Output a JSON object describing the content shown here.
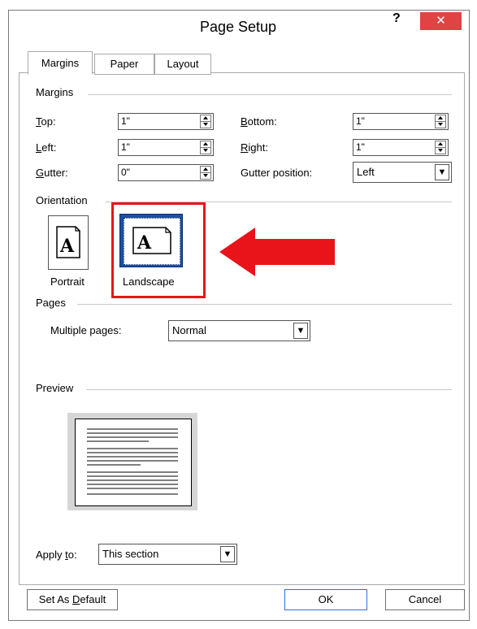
{
  "window": {
    "title": "Page Setup",
    "help_label": "?",
    "close_glyph": "✕"
  },
  "tabs": [
    {
      "label": "Margins",
      "active": true
    },
    {
      "label": "Paper"
    },
    {
      "label": "Layout"
    }
  ],
  "margins": {
    "section_label": "Margins",
    "top": {
      "label": "Top:",
      "value": "1\""
    },
    "bottom": {
      "label": "Bottom:",
      "value": "1\""
    },
    "left": {
      "label": "Left:",
      "value": "1\""
    },
    "right": {
      "label": "Right:",
      "value": "1\""
    },
    "gutter": {
      "label": "Gutter:",
      "value": "0\""
    },
    "gutter_position": {
      "label": "Gutter position:",
      "value": "Left"
    }
  },
  "orientation": {
    "section_label": "Orientation",
    "portrait": {
      "label": "Portrait",
      "icon": "portrait-page-icon"
    },
    "landscape": {
      "label": "Landscape",
      "icon": "landscape-page-icon",
      "selected": true
    },
    "highlight_color": "#e8141a"
  },
  "pages": {
    "section_label": "Pages",
    "multiple_pages_label": "Multiple pages:",
    "multiple_pages_value": "Normal"
  },
  "preview": {
    "section_label": "Preview"
  },
  "apply_to": {
    "label": "Apply to:",
    "value": "This section"
  },
  "buttons": {
    "set_default": "Set As Default",
    "ok": "OK",
    "cancel": "Cancel"
  }
}
